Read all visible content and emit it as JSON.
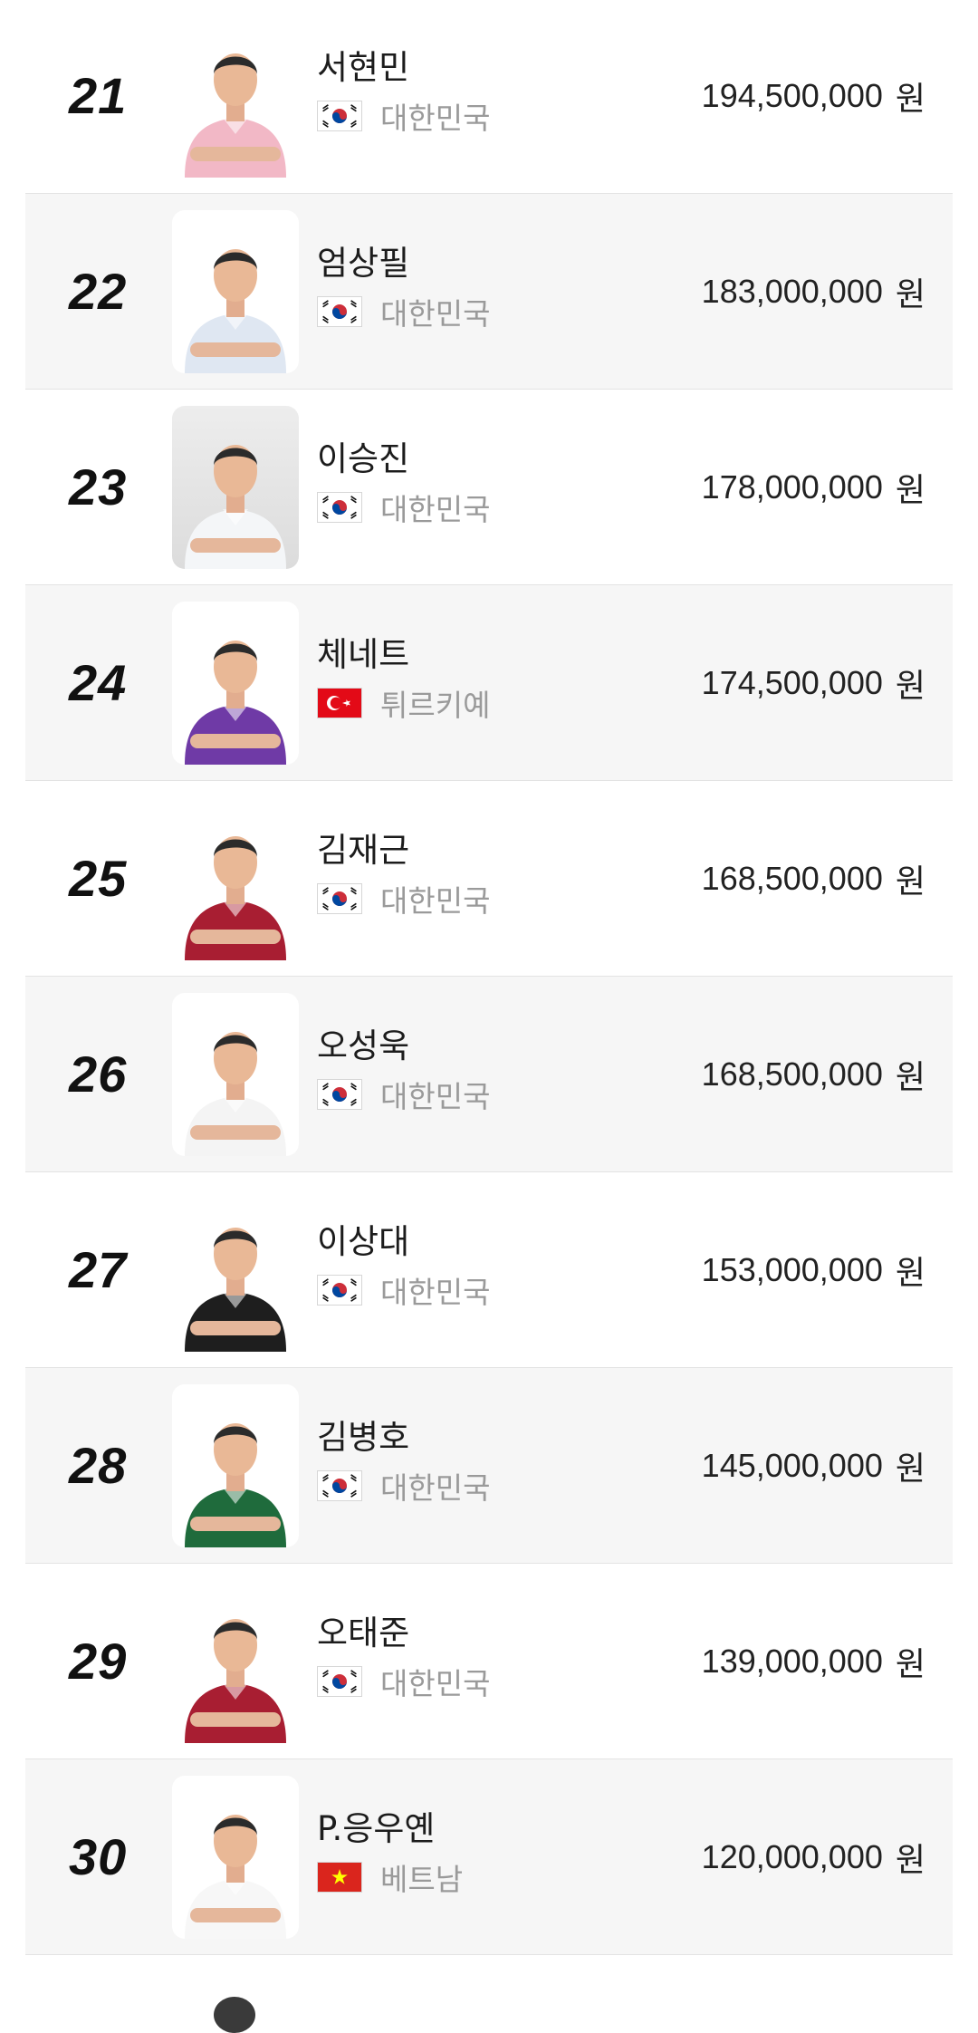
{
  "currency_unit": "원",
  "players": [
    {
      "rank": "21",
      "name": "서현민",
      "country": "대한민국",
      "flag": "kr",
      "prize": "194,500,000",
      "jersey_color": "#f2b8c6",
      "photo_bg": "white"
    },
    {
      "rank": "22",
      "name": "엄상필",
      "country": "대한민국",
      "flag": "kr",
      "prize": "183,000,000",
      "jersey_color": "#dfe7f2",
      "photo_bg": "white"
    },
    {
      "rank": "23",
      "name": "이승진",
      "country": "대한민국",
      "flag": "kr",
      "prize": "178,000,000",
      "jersey_color": "#f4f6f8",
      "photo_bg": "gray"
    },
    {
      "rank": "24",
      "name": "체네트",
      "country": "튀르키예",
      "flag": "tr",
      "prize": "174,500,000",
      "jersey_color": "#6f3aa6",
      "photo_bg": "white"
    },
    {
      "rank": "25",
      "name": "김재근",
      "country": "대한민국",
      "flag": "kr",
      "prize": "168,500,000",
      "jersey_color": "#a81e32",
      "photo_bg": "white"
    },
    {
      "rank": "26",
      "name": "오성욱",
      "country": "대한민국",
      "flag": "kr",
      "prize": "168,500,000",
      "jersey_color": "#f4f4f4",
      "photo_bg": "white"
    },
    {
      "rank": "27",
      "name": "이상대",
      "country": "대한민국",
      "flag": "kr",
      "prize": "153,000,000",
      "jersey_color": "#1e1e1e",
      "photo_bg": "white"
    },
    {
      "rank": "28",
      "name": "김병호",
      "country": "대한민국",
      "flag": "kr",
      "prize": "145,000,000",
      "jersey_color": "#1f6b3c",
      "photo_bg": "white"
    },
    {
      "rank": "29",
      "name": "오태준",
      "country": "대한민국",
      "flag": "kr",
      "prize": "139,000,000",
      "jersey_color": "#a81e32",
      "photo_bg": "white"
    },
    {
      "rank": "30",
      "name": "P.응우옌",
      "country": "베트남",
      "flag": "vn",
      "prize": "120,000,000",
      "jersey_color": "#f7f7f7",
      "photo_bg": "white"
    }
  ]
}
